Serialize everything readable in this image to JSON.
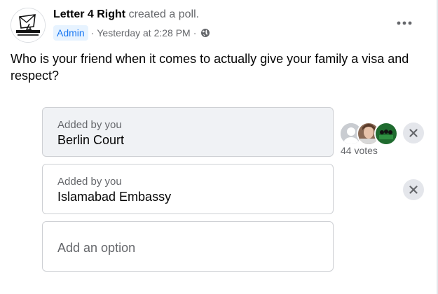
{
  "post": {
    "page_name": "Letter 4 Right",
    "action": "created a poll.",
    "badge": "Admin",
    "timestamp": "Yesterday at 2:28 PM",
    "separator": "·",
    "audience_icon": "globe-icon",
    "more_icon": "more-horizontal-icon"
  },
  "poll": {
    "question": "Who is your friend when it comes to actually give your family a visa and respect?",
    "options": [
      {
        "meta": "Added by you",
        "label": "Berlin Court",
        "votes_text": "44 votes",
        "remove_icon": "close-icon"
      },
      {
        "meta": "Added by you",
        "label": "Islamabad Embassy",
        "remove_icon": "close-icon"
      }
    ],
    "add_option_placeholder": "Add an option"
  },
  "colors": {
    "accent": "#1877f2",
    "admin_badge_bg": "#e7f3ff",
    "secondary_text": "#65676b",
    "selected_option_bg": "#f0f2f5",
    "button_bg": "#e4e6eb"
  }
}
